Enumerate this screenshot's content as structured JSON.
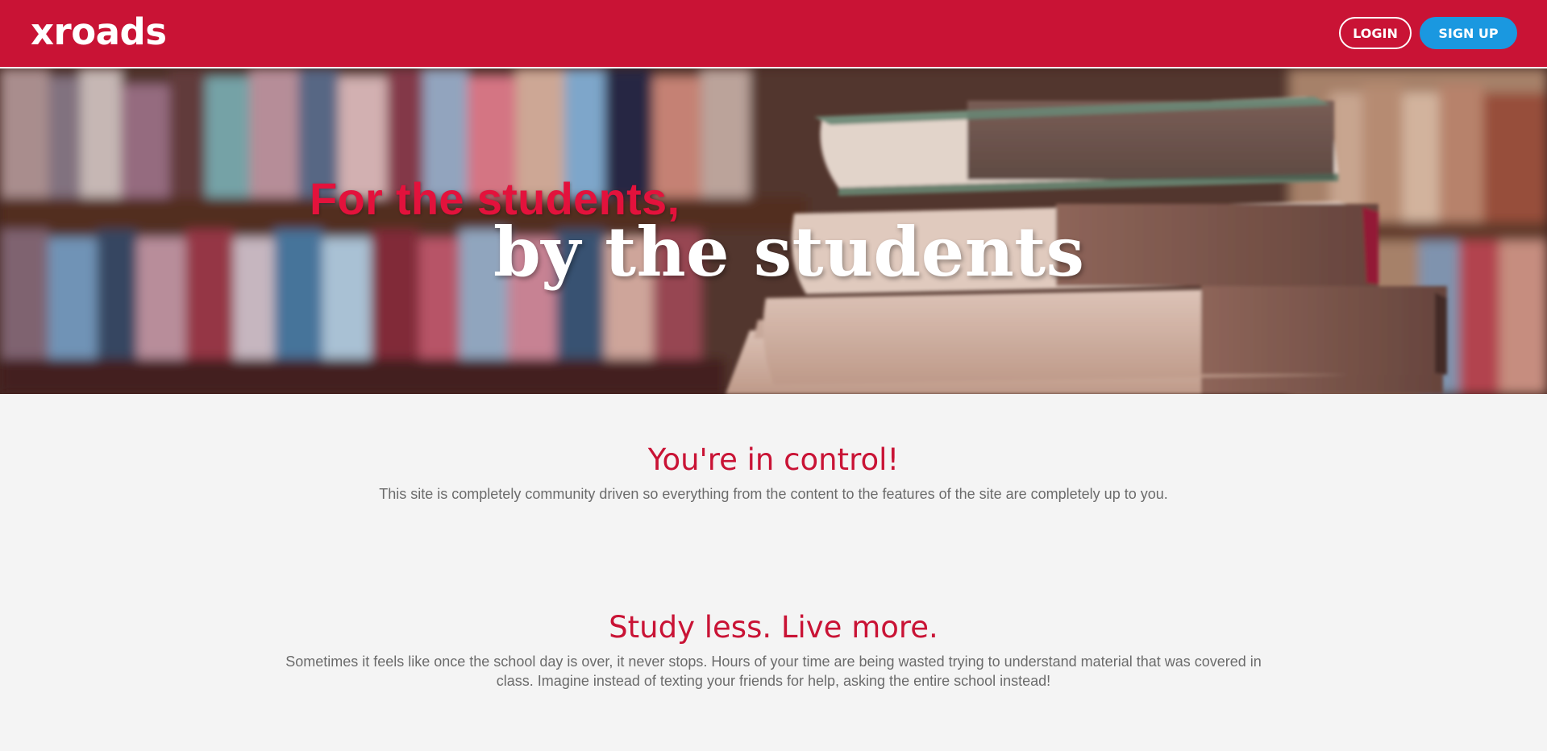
{
  "navbar": {
    "logo": "xroads",
    "login_label": "LOGIN",
    "signup_label": "SIGN UP",
    "colors": {
      "brand": "#c91335",
      "signup": "#1a98e0"
    }
  },
  "hero": {
    "line1": "For the students,",
    "line2": "by the students",
    "background": "blurred bookshelf with a stack of books"
  },
  "sections": [
    {
      "heading": "You're in control!",
      "body": "This site is completely community driven so everything from the content to the features of the site are completely up to you."
    },
    {
      "heading": "Study less. Live more.",
      "body": "Sometimes it feels like once the school day is over, it never stops. Hours of your time are being wasted trying to understand material that was covered in class. Imagine instead of texting your friends for help, asking the entire school instead!"
    }
  ]
}
